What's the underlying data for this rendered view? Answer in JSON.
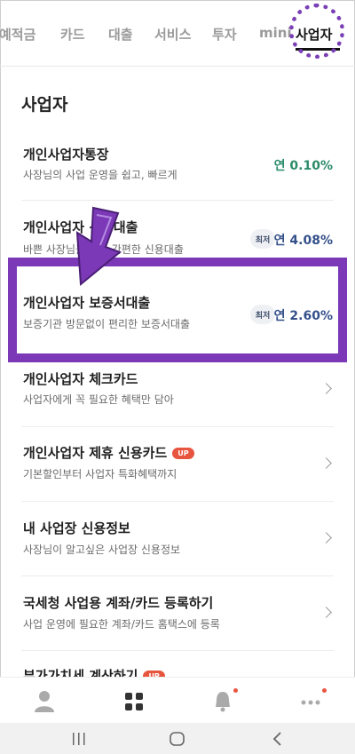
{
  "tabs": [
    {
      "label": "예적금"
    },
    {
      "label": "카드"
    },
    {
      "label": "대출"
    },
    {
      "label": "서비스"
    },
    {
      "label": "투자"
    },
    {
      "label": "mini"
    },
    {
      "label": "사업자"
    }
  ],
  "section": {
    "title": "사업자"
  },
  "items": [
    {
      "title": "개인사업자통장",
      "subtitle": "사장님의 사업 운영을 쉽고, 빠르게",
      "rate": "연 0.10%"
    },
    {
      "title": "개인사업자 신용대출",
      "subtitle": "바쁜 사장님을 위한 간편한 신용대출",
      "badge": "최저",
      "rate": "연 4.08%"
    },
    {
      "title": "개인사업자 보증서대출",
      "subtitle": "보증기관 방문없이 편리한 보증서대출",
      "badge": "최저",
      "rate": "연 2.60%"
    },
    {
      "title": "개인사업자 체크카드",
      "subtitle": "사업자에게 꼭 필요한 혜택만 담아"
    },
    {
      "title": "개인사업자 제휴 신용카드",
      "subtitle": "기본할인부터 사업자 특화혜택까지",
      "up_badge": "UP"
    },
    {
      "title": "내 사업장 신용정보",
      "subtitle": "사장님이 알고싶은 사업장 신용정보"
    },
    {
      "title": "국세청 사업용 계좌/카드 등록하기",
      "subtitle": "사업 운영에 필요한 계좌/카드 홈택스에 등록"
    },
    {
      "title": "부가가치세 계산하기",
      "up_badge": "UP"
    }
  ],
  "colors": {
    "accent_purple": "#7b39b8",
    "rate_green": "#2c8c6a",
    "rate_blue": "#34508a",
    "up_red": "#e8553f"
  },
  "icons": {
    "bottom_nav": [
      "person-icon",
      "grid-icon",
      "bell-icon",
      "more-icon"
    ],
    "system": [
      "recent-apps-icon",
      "home-icon",
      "back-icon"
    ]
  }
}
